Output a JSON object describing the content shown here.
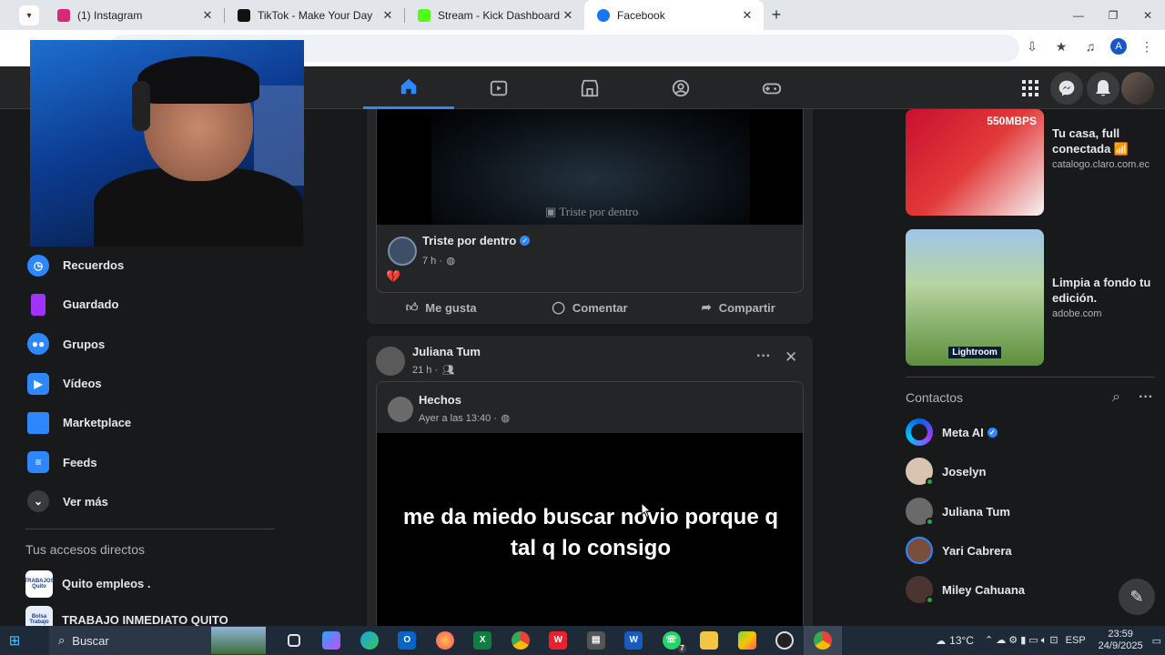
{
  "browser": {
    "tabs": [
      {
        "title": "(1) Instagram",
        "favicon_color": "#d62976",
        "active": false
      },
      {
        "title": "TikTok - Make Your Day",
        "favicon_color": "#111111",
        "active": false
      },
      {
        "title": "Stream - Kick Dashboard",
        "favicon_color": "#53fc18",
        "active": false
      },
      {
        "title": "Facebook",
        "favicon_color": "#1877f2",
        "active": true
      }
    ],
    "profile_initial": "A"
  },
  "sidebar": {
    "items": [
      {
        "label": "Recuerdos",
        "icon": "clock-icon",
        "color": "#2d88ff"
      },
      {
        "label": "Guardado",
        "icon": "bookmark-icon",
        "color": "#a033ff"
      },
      {
        "label": "Grupos",
        "icon": "groups-icon",
        "color": "#2d88ff"
      },
      {
        "label": "Vídeos",
        "icon": "video-icon",
        "color": "#2d88ff"
      },
      {
        "label": "Marketplace",
        "icon": "marketplace-icon",
        "color": "#2d88ff"
      },
      {
        "label": "Feeds",
        "icon": "feeds-icon",
        "color": "#2d88ff"
      },
      {
        "label": "Ver más",
        "icon": "chevron-down-icon",
        "color": "#3a3b3c"
      }
    ],
    "shortcuts_heading": "Tus accesos directos",
    "shortcuts": [
      {
        "label": "Quito empleos .",
        "thumb": "TRABAJOS Quito"
      },
      {
        "label": "TRABAJO INMEDIATO QUITO",
        "thumb": "Bolsa Trabajo"
      }
    ]
  },
  "post1": {
    "watermark": "Triste por dentro",
    "page_name": "Triste por dentro",
    "time": "7 h ·",
    "body": "💔",
    "like_label": "Me gusta",
    "comment_label": "Comentar",
    "share_label": "Compartir"
  },
  "post2": {
    "author": "Juliana Tum",
    "time": "21 h ·",
    "shared_name": "Hechos",
    "shared_time": "Ayer a las 13:40 ·",
    "caption": "me da miedo buscar novio porque q tal q lo consigo"
  },
  "ads": [
    {
      "title": "Tu casa, full conectada 📶",
      "domain": "catalogo.claro.com.ec",
      "image_text": "550MBPS"
    },
    {
      "title": "Limpia a fondo tu edición.",
      "domain": "adobe.com",
      "image_text": "Lightroom"
    }
  ],
  "contacts": {
    "heading": "Contactos",
    "people": [
      {
        "name": "Meta AI",
        "verified": true,
        "online": false
      },
      {
        "name": "Joselyn",
        "verified": false,
        "online": true
      },
      {
        "name": "Juliana Tum",
        "verified": false,
        "online": true
      },
      {
        "name": "Yari Cabrera",
        "verified": false,
        "online": false
      },
      {
        "name": "Miley Cahuana",
        "verified": false,
        "online": true
      }
    ]
  },
  "taskbar": {
    "search_placeholder": "Buscar",
    "weather": "13°C",
    "lang": "ESP",
    "time": "23:59",
    "date": "24/9/2025",
    "whatsapp_badge": "7"
  }
}
